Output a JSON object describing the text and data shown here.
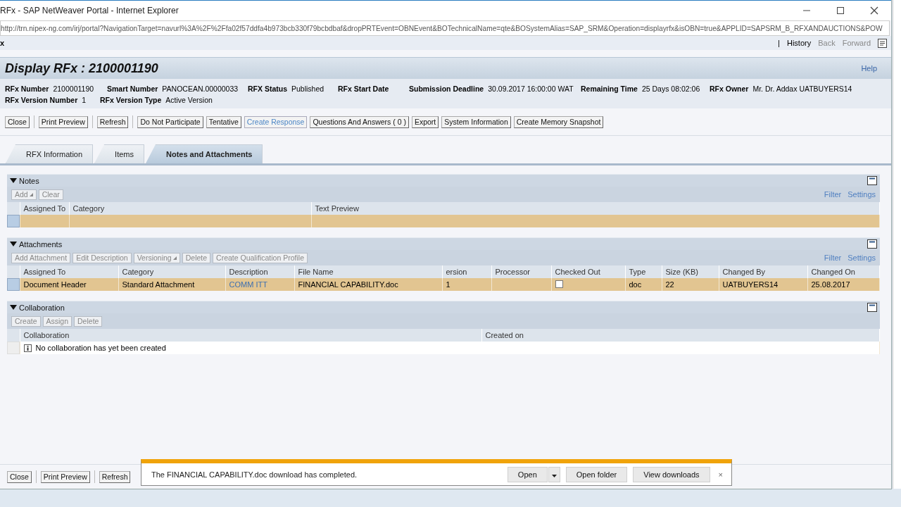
{
  "window": {
    "title": "RFx - SAP NetWeaver Portal - Internet Explorer",
    "address": "http://trn.nipex-ng.com/irj/portal?NavigationTarget=navurl%3A%2F%2Ffa02f57ddfa4b973bcb330f79bcbdbaf&dropPRTEvent=OBNEvent&BOTechnicalName=qte&BOSystemAlias=SAP_SRM&Operation=displayrfx&isOBN=true&APPLID=SAPSRM_B_RFXANDAUCTIONS&POW"
  },
  "portal_bar": {
    "page_label": "x",
    "divider": "|",
    "history": "History",
    "back": "Back",
    "forward": "Forward"
  },
  "page": {
    "title": "Display RFx : 2100001190",
    "help": "Help"
  },
  "fields": [
    [
      {
        "label": "RFx Number",
        "value": "2100001190"
      },
      {
        "label": "Smart Number",
        "value": "PANOCEAN.00000033"
      },
      {
        "label": "RFX Status",
        "value": "Published"
      },
      {
        "label": "RFx Start Date"
      },
      {
        "label": "Submission Deadline",
        "value": "30.09.2017 16:00:00 WAT"
      },
      {
        "label": "Remaining Time",
        "value": "25 Days 08:02:06"
      },
      {
        "label": "RFx Owner",
        "value": "Mr. Dr. Addax UATBUYERS14"
      }
    ],
    [
      {
        "label": "RFx Version Number",
        "value": "1"
      },
      {
        "label": "RFx Version Type",
        "value": "Active Version"
      }
    ]
  ],
  "toolbar": [
    [
      {
        "label": "Close",
        "hover": false
      }
    ],
    [
      {
        "label": "Print Preview",
        "hover": false
      }
    ],
    [
      {
        "label": "Refresh",
        "hover": false
      }
    ],
    [
      {
        "label": "Do Not Participate",
        "hover": false
      },
      {
        "label": "Tentative",
        "hover": false
      },
      {
        "label": "Create Response",
        "hover": true
      },
      {
        "label": "Questions And Answers ( 0 )",
        "hover": false
      },
      {
        "label": "Export",
        "hover": false
      },
      {
        "label": "System Information",
        "hover": false
      },
      {
        "label": "Create Memory Snapshot",
        "hover": false
      }
    ]
  ],
  "tabs": [
    {
      "label": "RFX Information",
      "selected": false
    },
    {
      "label": "Items",
      "selected": false
    },
    {
      "label": "Notes and Attachments",
      "selected": true
    }
  ],
  "trays": [
    {
      "title": "Notes",
      "expanded": true,
      "buttons": [
        {
          "label": "Add",
          "disabled": true,
          "menu": true
        },
        {
          "label": "Clear",
          "disabled": true,
          "menu": false
        }
      ],
      "filter": "Filter",
      "settings": "Settings",
      "columns": [
        "Assigned To",
        "Category",
        "Text Preview"
      ],
      "rows": [
        {
          "selected": true,
          "cells": [
            {
              "kind": "text"
            },
            {
              "kind": "text"
            },
            {
              "kind": "text"
            }
          ]
        }
      ]
    },
    {
      "title": "Attachments",
      "expanded": true,
      "buttons": [
        {
          "label": "Add Attachment",
          "disabled": true,
          "menu": false
        },
        {
          "label": "Edit Description",
          "disabled": true,
          "menu": false
        },
        {
          "label": "Versioning",
          "disabled": true,
          "menu": true
        },
        {
          "label": "Delete",
          "disabled": true,
          "menu": false
        },
        {
          "label": "Create Qualification Profile",
          "disabled": true,
          "menu": false
        }
      ],
      "filter": "Filter",
      "settings": "Settings",
      "columns": [
        "Assigned To",
        "Category",
        "Description",
        "File Name",
        "ersion",
        "Processor",
        "Checked Out",
        "Type",
        "Size (KB)",
        "Changed By",
        "Changed On"
      ],
      "rows": [
        {
          "selected": true,
          "cells": [
            {
              "kind": "text",
              "text": "Document Header"
            },
            {
              "kind": "text",
              "text": "Standard Attachment"
            },
            {
              "kind": "link",
              "text": "COMM ITT"
            },
            {
              "kind": "text",
              "text": "FINANCIAL CAPABILITY.doc"
            },
            {
              "kind": "text",
              "text": "1"
            },
            {
              "kind": "text"
            },
            {
              "kind": "checkbox",
              "checked": false
            },
            {
              "kind": "text",
              "text": "doc"
            },
            {
              "kind": "text",
              "text": "22"
            },
            {
              "kind": "text",
              "text": "UATBUYERS14"
            },
            {
              "kind": "text",
              "text": "25.08.2017"
            }
          ]
        }
      ]
    },
    {
      "title": "Collaboration",
      "expanded": true,
      "buttons": [
        {
          "label": "Create",
          "disabled": true,
          "menu": false
        },
        {
          "label": "Assign",
          "disabled": true,
          "menu": false
        },
        {
          "label": "Delete",
          "disabled": true,
          "menu": false
        }
      ],
      "columns": [
        "Collaboration",
        "Created on"
      ],
      "rows": [
        {
          "selected": false,
          "message": "No collaboration has yet been created"
        }
      ]
    }
  ],
  "bottom_toolbar": [
    {
      "label": "Close"
    },
    {
      "label": "Print Preview"
    },
    {
      "label": "Refresh"
    }
  ],
  "download_bar": {
    "message": "The FINANCIAL CAPABILITY.doc download has completed.",
    "open": "Open",
    "open_folder": "Open folder",
    "view_downloads": "View downloads",
    "close": "×"
  }
}
